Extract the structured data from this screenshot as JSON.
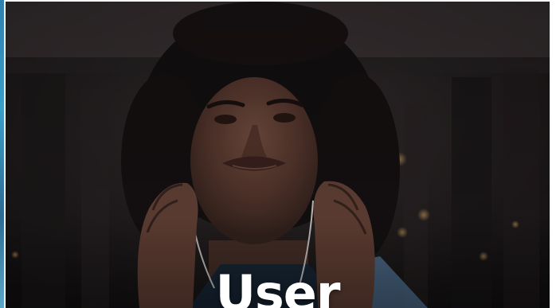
{
  "hero": {
    "title": "User",
    "image_icon": "woman-listening-to-earphones-photo"
  },
  "carousel": {
    "prev_slide_icon": "previous-slide-peek",
    "next_slide_icon": "next-slide-peek"
  }
}
